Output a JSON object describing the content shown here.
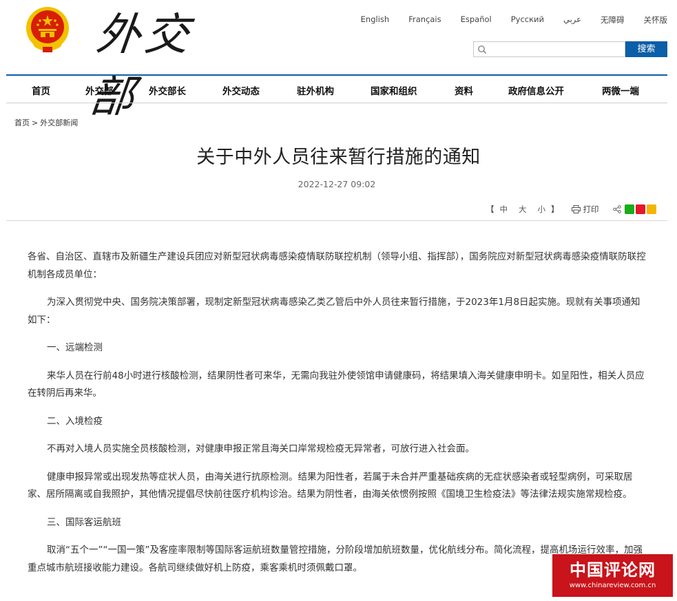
{
  "header": {
    "logo_text": "外交部",
    "languages": [
      "English",
      "Français",
      "Español",
      "Русский",
      "عربي",
      "无障碍",
      "关怀版"
    ],
    "search": {
      "placeholder": "",
      "button_label": "搜索"
    }
  },
  "nav": {
    "items": [
      "首页",
      "外交部",
      "外交部长",
      "外交动态",
      "驻外机构",
      "国家和组织",
      "资料",
      "政府信息公开",
      "两微一端"
    ]
  },
  "breadcrumb": {
    "home": "首页",
    "separator": ">",
    "current": "外交部新闻"
  },
  "article": {
    "title": "关于中外人员往来暂行措施的通知",
    "date": "2022-12-27 09:02",
    "tools": {
      "bracket_open": "【",
      "font_sizes": [
        "中",
        "大",
        "小"
      ],
      "bracket_close": "】",
      "print_label": "打印"
    },
    "paragraphs": [
      "各省、自治区、直辖市及新疆生产建设兵团应对新型冠状病毒感染疫情联防联控机制（领导小组、指挥部），国务院应对新型冠状病毒感染疫情联防联控机制各成员单位：",
      "为深入贯彻党中央、国务院决策部署，现制定新型冠状病毒感染乙类乙管后中外人员往来暂行措施，于2023年1月8日起实施。现就有关事项通知如下：",
      "一、远端检测",
      "来华人员在行前48小时进行核酸检测，结果阴性者可来华，无需向我驻外使领馆申请健康码，将结果填入海关健康申明卡。如呈阳性，相关人员应在转阴后再来华。",
      "二、入境检疫",
      "不再对入境人员实施全员核酸检测，对健康申报正常且海关口岸常规检疫无异常者，可放行进入社会面。",
      "健康申报异常或出现发热等症状人员，由海关进行抗原检测。结果为阳性者，若属于未合并严重基础疾病的无症状感染者或轻型病例，可采取居家、居所隔离或自我照护，其他情况提倡尽快前往医疗机构诊治。结果为阴性者，由海关依惯例按照《国境卫生检疫法》等法律法规实施常规检疫。",
      "三、国际客运航班",
      "取消“五个一”“一国一策”及客座率限制等国际客运航班数量管控措施，分阶段增加航班数量，优化航线分布。简化流程，提高机场运行效率，加强重点城市航班接收能力建设。各航司继续做好机上防疫，乘客乘机时须佩戴口罩。"
    ]
  },
  "watermark": {
    "text": "中国评论网",
    "url": "www.chinareview.com.cn"
  },
  "colors": {
    "nav_border": "#0b5ea8",
    "search_button": "#0b5ea8",
    "watermark_bg": "#c8141a",
    "emblem_red": "#d81e06",
    "emblem_gold": "#f2c200"
  }
}
